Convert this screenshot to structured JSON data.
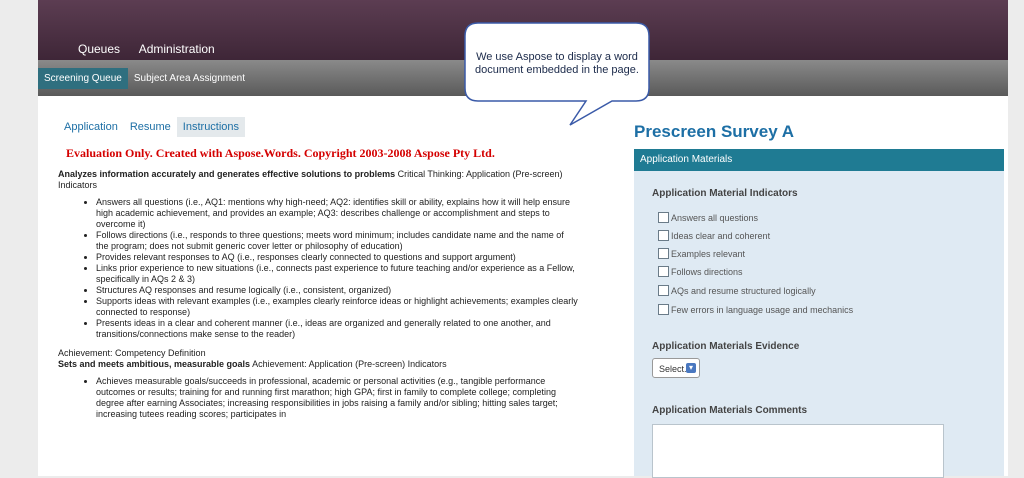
{
  "nav": {
    "items": [
      "Queues",
      "Administration"
    ]
  },
  "subnav": {
    "items": [
      "Screening Queue",
      "Subject Area Assignment"
    ]
  },
  "tabs": [
    "Application",
    "Resume",
    "Instructions"
  ],
  "callout": {
    "text": "We use Aspose to display a word document embedded in the page."
  },
  "doc": {
    "eval_notice": "Evaluation Only. Created with Aspose.Words. Copyright 2003-2008 Aspose Pty Ltd.",
    "heading1_bold": "Analyzes information accurately and generates effective solutions to problems",
    "heading1_rest": " Critical Thinking: Application (Pre-screen) Indicators",
    "bullets1": [
      "Answers all questions (i.e., AQ1: mentions why high-need; AQ2: identifies skill or ability, explains how it will help ensure high academic achievement, and provides an example; AQ3: describes challenge or accomplishment and steps to overcome it)",
      "Follows directions (i.e., responds to three questions; meets word minimum; includes candidate name and the name of the program; does not submit generic cover letter or philosophy of education)",
      "Provides relevant responses to AQ (i.e., responses clearly connected to questions and support argument)",
      "Links prior experience to new situations (i.e., connects past experience to future teaching and/or experience as a Fellow, specifically in AQs 2 & 3)",
      "Structures AQ responses and resume logically (i.e., consistent, organized)",
      "Supports ideas with relevant examples (i.e., examples clearly reinforce ideas or highlight achievements; examples clearly connected to response)",
      "Presents ideas in a clear and coherent manner (i.e., ideas are organized and generally related to one another, and transitions/connections make sense to the reader)"
    ],
    "achievement_def": "Achievement: Competency Definition",
    "heading2_bold": "Sets and meets ambitious, measurable goals",
    "heading2_rest": " Achievement: Application (Pre-screen) Indicators",
    "bullets2": [
      "Achieves measurable goals/succeeds in professional, academic or personal activities (e.g., tangible performance outcomes or results; training for and running first marathon; high GPA; first in family to complete college; completing degree after earning Associates; increasing responsibilities in jobs raising a family and/or sibling; hitting sales target; increasing tutees reading scores; participates in"
    ]
  },
  "survey": {
    "title": "Prescreen Survey A",
    "panel_title": "Application Materials",
    "indicators_label": "Application Material Indicators",
    "indicators": [
      "Answers all questions",
      "Ideas clear and coherent",
      "Examples relevant",
      "Follows directions",
      "AQs and resume structured logically",
      "Few errors in language usage and mechanics"
    ],
    "evidence_label": "Application Materials Evidence",
    "evidence_select": "Select...",
    "comments_label": "Application Materials Comments"
  }
}
